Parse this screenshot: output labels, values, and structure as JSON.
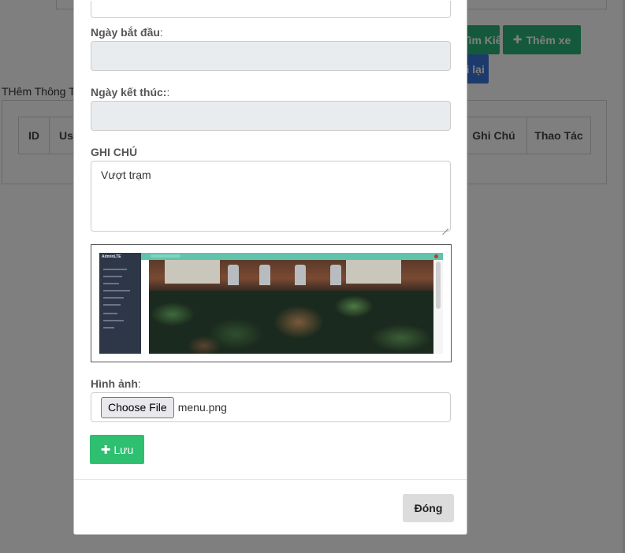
{
  "background": {
    "search_button_label": "Tìm Kiếm",
    "add_button_label": "Thêm xe",
    "reload_button_label": "Tải lại",
    "form_title": "THêm Thông Tin",
    "table_headers": [
      "ID",
      "Us",
      "Ghi Chú",
      "Thao Tác"
    ]
  },
  "modal": {
    "start_date_label": "Ngày bắt đầu",
    "start_date_suffix": ":",
    "start_date_value": "",
    "end_date_label": "Ngày kết thúc:",
    "end_date_suffix": ":",
    "end_date_value": "",
    "note_label": "GHI CHÚ",
    "note_value": "Vượt trạm",
    "image_label": "Hình ảnh",
    "image_label_suffix": ":",
    "choose_file_label": "Choose File",
    "file_name": "menu.png",
    "save_label": "Lưu",
    "close_label": "Đóng",
    "preview_logo_text": "AdminLTE"
  },
  "colors": {
    "green": "#2ab27b",
    "save_green": "#2fbf71",
    "blue": "#3874d8",
    "readonly_bg": "#e9ecef",
    "close_bg": "#dcdcdc"
  },
  "icons": {
    "plus": "plus-icon",
    "resize": "resize-handle-icon"
  }
}
